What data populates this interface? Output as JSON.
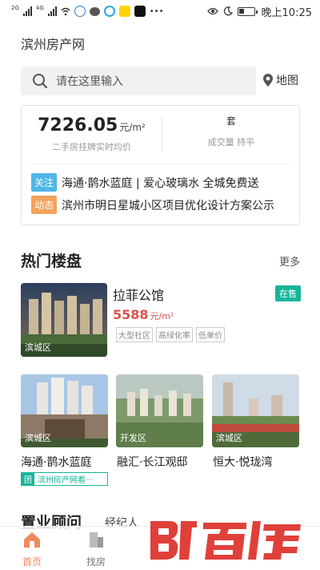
{
  "status_bar": {
    "net1": "2G",
    "net2": "4G",
    "time": "晚上10:25"
  },
  "header": {
    "title": "滨州房产网"
  },
  "search": {
    "placeholder": "请在这里输入",
    "map_label": "地图"
  },
  "price_card": {
    "price": "7226.05",
    "price_unit": "元/m²",
    "price_desc": "二手房挂牌实时均价",
    "volume_unit": "套",
    "volume_desc": "成交量 持平",
    "news": [
      {
        "tag": "关注",
        "tag_color": "#4fb6e8",
        "text": "海通·鹊水蓝庭 | 爱心玻璃水 全城免费送"
      },
      {
        "tag": "动态",
        "tag_color": "#f3a35c",
        "text": "滨州市明日星城小区项目优化设计方案公示"
      }
    ]
  },
  "hot": {
    "title": "热门楼盘",
    "more": "更多",
    "featured": {
      "name": "拉菲公馆",
      "status": "在售",
      "price": "5588",
      "price_unit": "元/m²",
      "district": "滨城区",
      "tags": [
        "大型社区",
        "高绿化率",
        "低单价"
      ]
    },
    "cards": [
      {
        "name": "海通·鹊水蓝庭",
        "district": "滨城区"
      },
      {
        "name": "融汇·长江观邸",
        "district": "开发区"
      },
      {
        "name": "恒大·悦珑湾",
        "district": "滨城区"
      }
    ],
    "group_tag": "团",
    "group_text": "滨州房产网看···"
  },
  "advisor": {
    "title": "置业顾问",
    "subtitle": "经纪人"
  },
  "tabs": [
    {
      "label": "首页"
    },
    {
      "label": "找房"
    }
  ],
  "colors": {
    "accent": "#17b59a",
    "price_red": "#d9534f",
    "tab_active": "#f08a5d",
    "watermark_red": "#e0403a"
  }
}
